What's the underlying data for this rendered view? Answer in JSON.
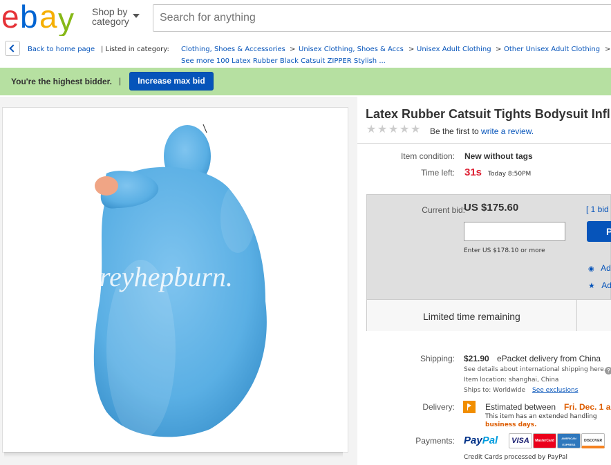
{
  "header": {
    "logo_letters": [
      "e",
      "b",
      "a",
      "y"
    ],
    "logo_colors": [
      "#e53238",
      "#0064d2",
      "#f5af02",
      "#86b817"
    ],
    "shop_by": "Shop by",
    "category": "category",
    "search_placeholder": "Search for anything"
  },
  "breadcrumb": {
    "back_label": "Back to home page",
    "listed_label": "| Listed in category:",
    "categories": [
      "Clothing, Shoes & Accessories",
      "Unisex Clothing, Shoes & Accs",
      "Unisex Adult Clothing",
      "Other Unisex Adult Clothing"
    ],
    "separator": ">",
    "see_more": "See more 100 Latex Rubber Black Catsuit ZIPPER Stylish ..."
  },
  "bid_status": {
    "message": "You're the highest bidder.",
    "pipe": "|",
    "increase_label": "Increase max bid"
  },
  "image": {
    "watermark": "dreyhepburn."
  },
  "item": {
    "title": "Latex Rubber Catsuit Tights Bodysuit Infl",
    "review_prefix": "Be the first to",
    "review_link": "write a review.",
    "condition_label": "Item condition:",
    "condition_value": "New without tags",
    "time_label": "Time left:",
    "time_value": "31s",
    "time_end": "Today 8:50PM"
  },
  "bidding": {
    "current_bid_label": "Current bid:",
    "current_bid_value": "US $175.60",
    "bids_link": "[ 1 bid",
    "place_bid_label": "P",
    "enter_note": "Enter US $178.10 or more",
    "watch_label": "Ad",
    "add_list_label": "Ad",
    "limited_label": "Limited time remaining"
  },
  "shipping": {
    "label": "Shipping:",
    "cost": "$21.90",
    "method": "ePacket delivery from China",
    "details_note": "See details about international shipping here.",
    "location": "Item location:  shanghai, China",
    "ships_to": "Ships to:  Worldwide",
    "exclusions": "See exclusions"
  },
  "delivery": {
    "label": "Delivery:",
    "estimated": "Estimated between",
    "date": "Fri. Dec. 1 a",
    "handling_note": "This item has an extended handling",
    "business_days": "business days."
  },
  "payments": {
    "label": "Payments:",
    "paypal_pay": "Pay",
    "paypal_pal": "Pal",
    "cards": [
      "VISA",
      "MasterCard",
      "AMERICAN EXPRESS",
      "DISCOVER"
    ],
    "processed_note": "Credit Cards processed by PayPal"
  }
}
